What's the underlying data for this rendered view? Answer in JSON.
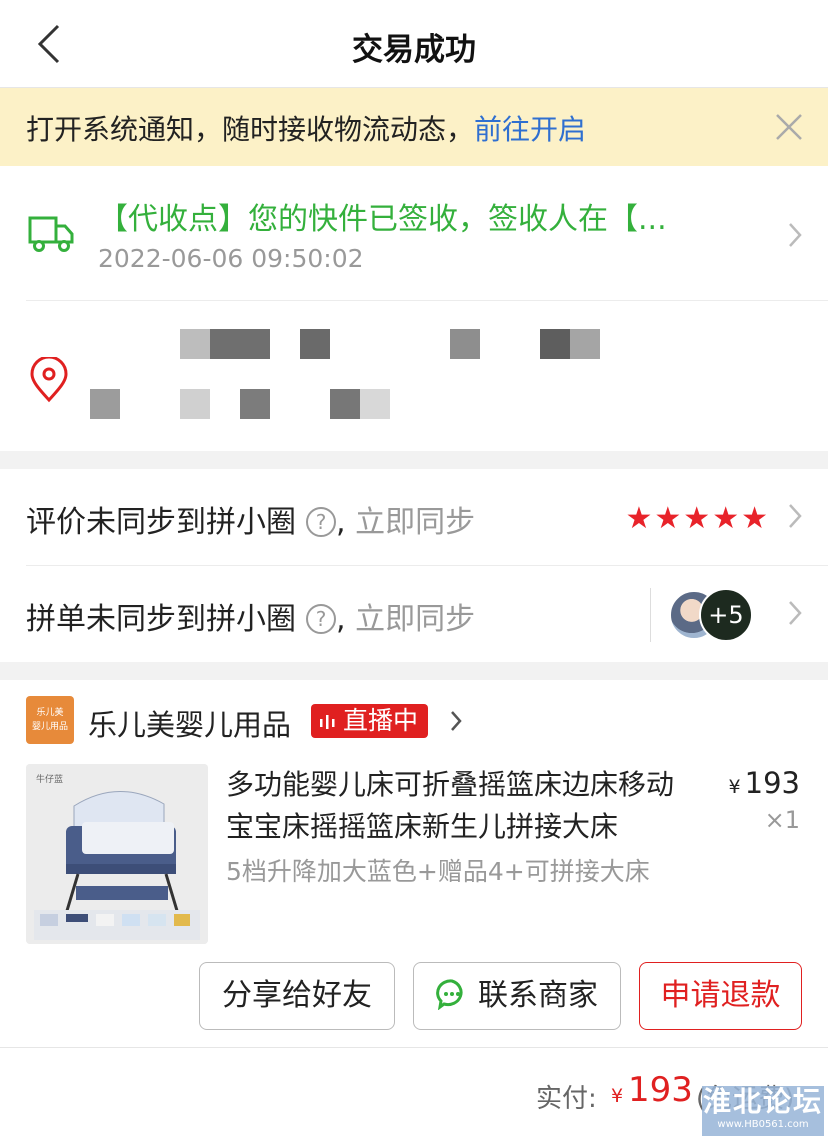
{
  "header": {
    "title": "交易成功"
  },
  "notice": {
    "text": "打开系统通知，随时接收物流动态，",
    "link": "前往开启"
  },
  "logistics": {
    "status": "【代收点】您的快件已签收，签收人在【...",
    "time": "2022-06-06 09:50:02"
  },
  "review_row": {
    "label": "评价未同步到拼小圈",
    "punct": ",",
    "action": "立即同步",
    "stars": "★★★★★",
    "rating": 5
  },
  "group_row": {
    "label": "拼单未同步到拼小圈",
    "punct": ",",
    "action": "立即同步",
    "more_count": "+5"
  },
  "shop": {
    "logo_text": "乐儿美\n婴儿用品",
    "name": "乐儿美婴儿用品",
    "live_label": "直播中"
  },
  "product": {
    "image_caption": "牛仔蓝",
    "title": "多功能婴儿床可折叠摇篮床边床移动宝宝床摇摇篮床新生儿拼接大床",
    "spec": "5档升降加大蓝色+赠品4+可拼接大床",
    "currency": "¥",
    "price": "193",
    "qty": "×1"
  },
  "actions": {
    "share": "分享给好友",
    "contact": "联系商家",
    "refund": "申请退款"
  },
  "total": {
    "label": "实付:",
    "currency": "¥",
    "amount": "193",
    "note": "(免运费)"
  },
  "watermark": {
    "big": "淮北论坛",
    "small": "www.HB0561.com"
  },
  "colors": {
    "accent_red": "#e02020",
    "green": "#34b03c",
    "link_blue": "#2f6fd0",
    "notice_bg": "#fcf1c7"
  }
}
